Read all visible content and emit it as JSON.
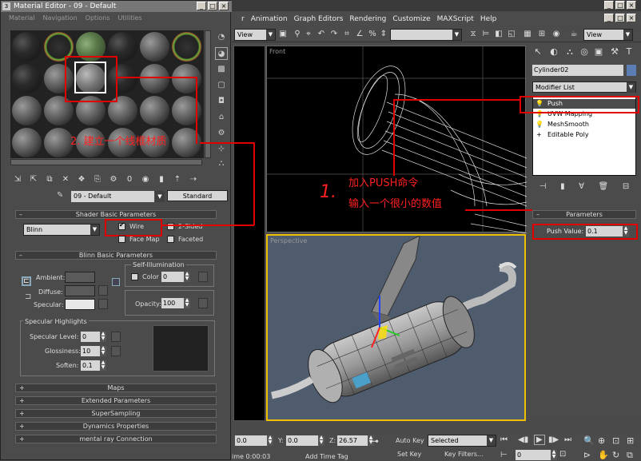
{
  "max": {
    "menu": [
      "r",
      "Animation",
      "Graph Editors",
      "Rendering",
      "Customize",
      "MAXScript",
      "Help"
    ],
    "view_dd": "View",
    "view_dd2": "View",
    "viewports": {
      "front": "Front",
      "persp": "Perspective"
    }
  },
  "cmd": {
    "object_name": "Cylinder02",
    "modifier_list": "Modifier List",
    "stack": [
      "Push",
      "UVW Mapping",
      "MeshSmooth",
      "Editable Poly"
    ],
    "params_header": "Parameters",
    "push_label": "Push Value:",
    "push_value": "0.1",
    "object_color": "#5b7fb5"
  },
  "bottom": {
    "x": "0.0",
    "y_label": "Y:",
    "y": "0.0",
    "z_label": "Z:",
    "z": "26.57",
    "autokey": "Auto Key",
    "selected": "Selected",
    "setkey": "Set Key",
    "keyfilters": "Key Filters...",
    "time": "ime 0:00:03",
    "addtimetag": "Add Time Tag",
    "frame": "0"
  },
  "me": {
    "title": "Material Editor - 09 - Default",
    "menu": [
      "Material",
      "Navigation",
      "Options",
      "Utilities"
    ],
    "mat_name": "09 - Default",
    "mat_type": "Standard",
    "shader_hdr": "Shader Basic Parameters",
    "shader": "Blinn",
    "wire": "Wire",
    "two_sided": "2-Sided",
    "face_map": "Face Map",
    "faceted": "Faceted",
    "blinn_hdr": "Blinn Basic Parameters",
    "self_illum": "Self-Illumination",
    "ambient": "Ambient:",
    "diffuse": "Diffuse:",
    "specular": "Specular:",
    "color_label": "Color",
    "color_val": "0",
    "opacity_label": "Opacity:",
    "opacity_val": "100",
    "spec_hl": "Specular Highlights",
    "spec_level_label": "Specular Level:",
    "spec_level": "0",
    "gloss_label": "Glossiness:",
    "gloss": "10",
    "soften_label": "Soften:",
    "soften": "0.1",
    "rollouts": [
      "Maps",
      "Extended Parameters",
      "SuperSampling",
      "Dynamics Properties",
      "mental ray Connection"
    ]
  },
  "annotations": {
    "step2": "2. 建立一个线框材质",
    "step1_num": "1.",
    "step1_line1": "加入PUSH命令",
    "step1_line2": "输入一个很小的数值"
  }
}
